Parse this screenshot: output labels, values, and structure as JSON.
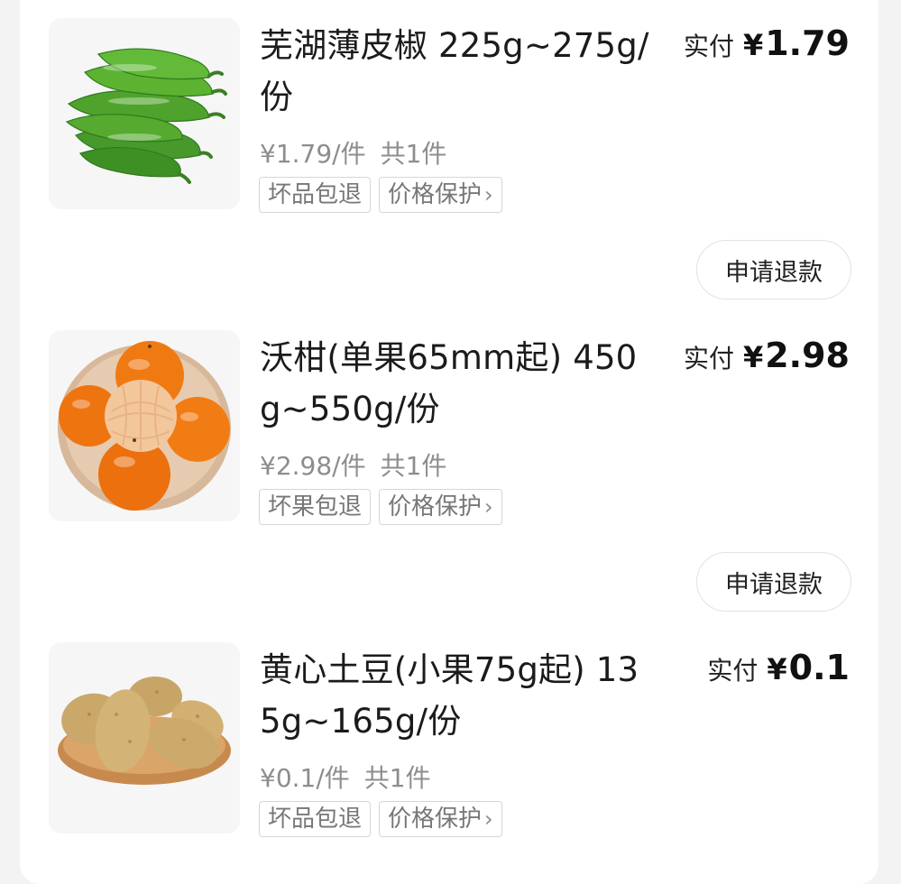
{
  "orders": [
    {
      "title": "芜湖薄皮椒 225g~275g/份",
      "unit_price": "¥1.79/件",
      "quantity": "共1件",
      "tags": [
        "坏品包退",
        "价格保护"
      ],
      "paid_label": "实付",
      "currency": "¥",
      "paid_amount": "1.79",
      "refund_label": "申请退款",
      "image_icon": "green-pepper-image"
    },
    {
      "title": "沃柑(单果65mm起) 450g~550g/份",
      "unit_price": "¥2.98/件",
      "quantity": "共1件",
      "tags": [
        "坏果包退",
        "价格保护"
      ],
      "paid_label": "实付",
      "currency": "¥",
      "paid_amount": "2.98",
      "refund_label": "申请退款",
      "image_icon": "mandarin-orange-image"
    },
    {
      "title": "黄心土豆(小果75g起) 135g~165g/份",
      "unit_price": "¥0.1/件",
      "quantity": "共1件",
      "tags": [
        "坏品包退",
        "价格保护"
      ],
      "paid_label": "实付",
      "currency": "¥",
      "paid_amount": "0.1",
      "image_icon": "potato-image"
    }
  ],
  "colors": {
    "background": "#f3f3f3",
    "card": "#ffffff",
    "muted_text": "#8d8d8d",
    "tag_border": "#d6d6d6"
  }
}
